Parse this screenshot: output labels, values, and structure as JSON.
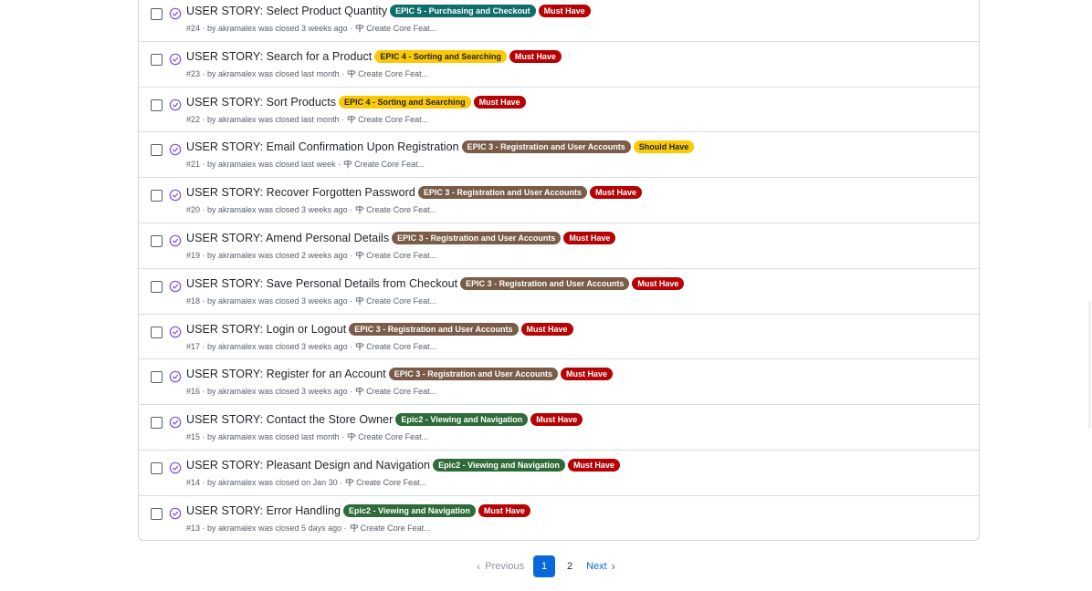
{
  "issues": [
    {
      "title": "USER STORY: Select Product Quantity",
      "labels": [
        {
          "text": "EPIC 5 - Purchasing and Checkout",
          "bg": "#0e6e6a",
          "fg": "#ffffff"
        },
        {
          "text": "Must Have",
          "bg": "#b60205",
          "fg": "#ffffff"
        }
      ],
      "meta": "#24 · by akramalex was closed 3 weeks ago ·",
      "milestone": "Create Core Feat..."
    },
    {
      "title": "USER STORY: Search for a Product",
      "labels": [
        {
          "text": "EPIC 4 - Sorting and Searching",
          "bg": "#fbca04",
          "fg": "#1f2328"
        },
        {
          "text": "Must Have",
          "bg": "#b60205",
          "fg": "#ffffff"
        }
      ],
      "meta": "#23 · by akramalex was closed last month ·",
      "milestone": "Create Core Feat..."
    },
    {
      "title": "USER STORY: Sort Products",
      "labels": [
        {
          "text": "EPIC 4 - Sorting and Searching",
          "bg": "#fbca04",
          "fg": "#1f2328"
        },
        {
          "text": "Must Have",
          "bg": "#b60205",
          "fg": "#ffffff"
        }
      ],
      "meta": "#22 · by akramalex was closed last month ·",
      "milestone": "Create Core Feat..."
    },
    {
      "title": "USER STORY: Email Confirmation Upon Registration",
      "labels": [
        {
          "text": "EPIC 3 - Registration and User Accounts",
          "bg": "#7a5c48",
          "fg": "#ffffff"
        },
        {
          "text": "Should Have",
          "bg": "#fbca04",
          "fg": "#1f2328"
        }
      ],
      "meta": "#21 · by akramalex was closed last week ·",
      "milestone": "Create Core Feat..."
    },
    {
      "title": "USER STORY: Recover Forgotten Password",
      "labels": [
        {
          "text": "EPIC 3 - Registration and User Accounts",
          "bg": "#7a5c48",
          "fg": "#ffffff"
        },
        {
          "text": "Must Have",
          "bg": "#b60205",
          "fg": "#ffffff"
        }
      ],
      "meta": "#20 · by akramalex was closed 3 weeks ago ·",
      "milestone": "Create Core Feat..."
    },
    {
      "title": "USER STORY: Amend Personal Details",
      "labels": [
        {
          "text": "EPIC 3 - Registration and User Accounts",
          "bg": "#7a5c48",
          "fg": "#ffffff"
        },
        {
          "text": "Must Have",
          "bg": "#b60205",
          "fg": "#ffffff"
        }
      ],
      "meta": "#19 · by akramalex was closed 2 weeks ago ·",
      "milestone": "Create Core Feat..."
    },
    {
      "title": "USER STORY: Save Personal Details from Checkout",
      "labels": [
        {
          "text": "EPIC 3 - Registration and User Accounts",
          "bg": "#7a5c48",
          "fg": "#ffffff"
        },
        {
          "text": "Must Have",
          "bg": "#b60205",
          "fg": "#ffffff"
        }
      ],
      "meta": "#18 · by akramalex was closed 3 weeks ago ·",
      "milestone": "Create Core Feat..."
    },
    {
      "title": "USER STORY: Login or Logout",
      "labels": [
        {
          "text": "EPIC 3 - Registration and User Accounts",
          "bg": "#7a5c48",
          "fg": "#ffffff"
        },
        {
          "text": "Must Have",
          "bg": "#b60205",
          "fg": "#ffffff"
        }
      ],
      "meta": "#17 · by akramalex was closed 3 weeks ago ·",
      "milestone": "Create Core Feat..."
    },
    {
      "title": "USER STORY: Register for an Account",
      "labels": [
        {
          "text": "EPIC 3 - Registration and User Accounts",
          "bg": "#7a5c48",
          "fg": "#ffffff"
        },
        {
          "text": "Must Have",
          "bg": "#b60205",
          "fg": "#ffffff"
        }
      ],
      "meta": "#16 · by akramalex was closed 3 weeks ago ·",
      "milestone": "Create Core Feat..."
    },
    {
      "title": "USER STORY: Contact the Store Owner",
      "labels": [
        {
          "text": "Epic2 - Viewing and Navigation",
          "bg": "#2f6b3a",
          "fg": "#ffffff"
        },
        {
          "text": "Must Have",
          "bg": "#b60205",
          "fg": "#ffffff"
        }
      ],
      "meta": "#15 · by akramalex was closed last month ·",
      "milestone": "Create Core Feat..."
    },
    {
      "title": "USER STORY: Pleasant Design and Navigation",
      "labels": [
        {
          "text": "Epic2 - Viewing and Navigation",
          "bg": "#2f6b3a",
          "fg": "#ffffff"
        },
        {
          "text": "Must Have",
          "bg": "#b60205",
          "fg": "#ffffff"
        }
      ],
      "meta": "#14 · by akramalex was closed on Jan 30 ·",
      "milestone": "Create Core Feat..."
    },
    {
      "title": "USER STORY: Error Handling",
      "labels": [
        {
          "text": "Epic2 - Viewing and Navigation",
          "bg": "#2f6b3a",
          "fg": "#ffffff"
        },
        {
          "text": "Must Have",
          "bg": "#b60205",
          "fg": "#ffffff"
        }
      ],
      "meta": "#13 · by akramalex was closed 5 days ago ·",
      "milestone": "Create Core Feat..."
    }
  ],
  "pagination": {
    "previous": "Previous",
    "pages": [
      "1",
      "2"
    ],
    "current": "1",
    "next": "Next"
  },
  "colors": {
    "closed_icon": "#8250df",
    "accent": "#0969da"
  }
}
